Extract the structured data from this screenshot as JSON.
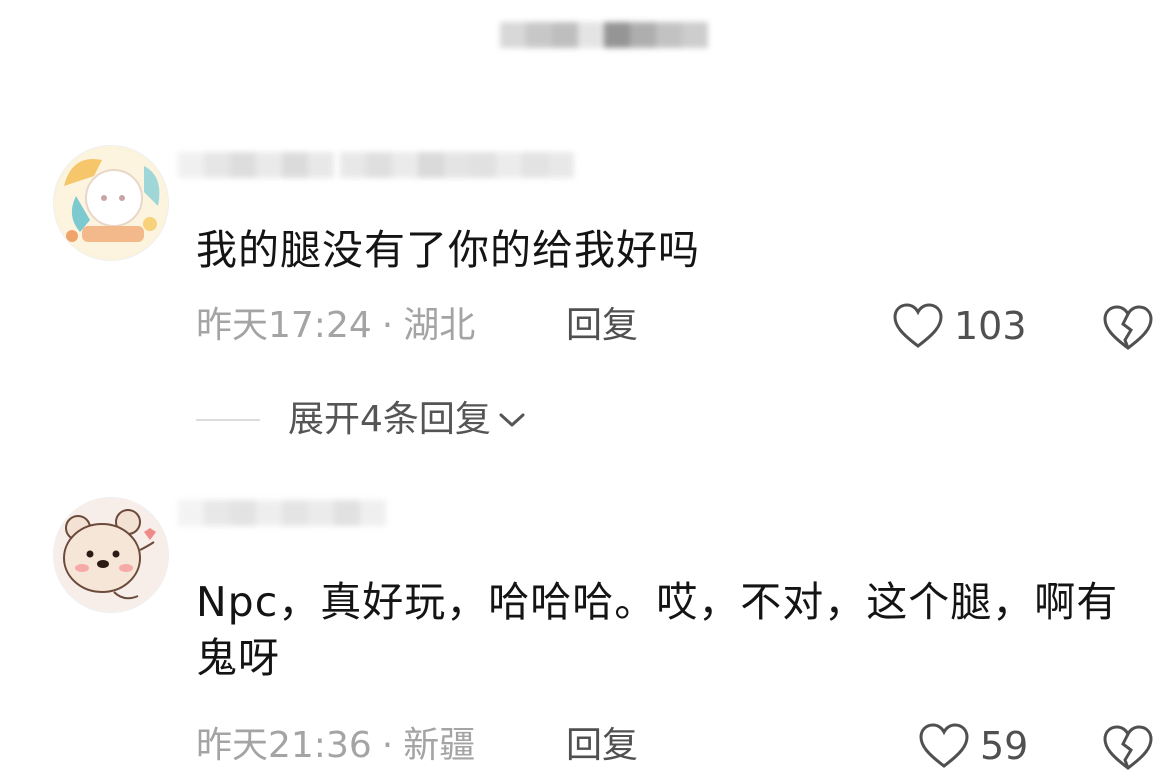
{
  "comments": [
    {
      "text": "我的腿没有了你的给我好吗",
      "time": "昨天17:24",
      "separator": "·",
      "location": "湖北",
      "reply_label": "回复",
      "like_count": "103",
      "avatar_icon": "cartoon-girl-avatar",
      "expand_label": "展开4条回复"
    },
    {
      "text": "Npc，真好玩，哈哈哈。哎，不对，这个腿，啊有鬼呀",
      "time": "昨天21:36",
      "separator": "·",
      "location": "新疆",
      "reply_label": "回复",
      "like_count": "59",
      "avatar_icon": "cartoon-bear-avatar"
    }
  ],
  "colors": {
    "text": "#141414",
    "meta": "#a4a4a4",
    "action": "#505050"
  },
  "icons": [
    "heart-outline-icon",
    "broken-heart-icon",
    "chevron-down-icon"
  ]
}
